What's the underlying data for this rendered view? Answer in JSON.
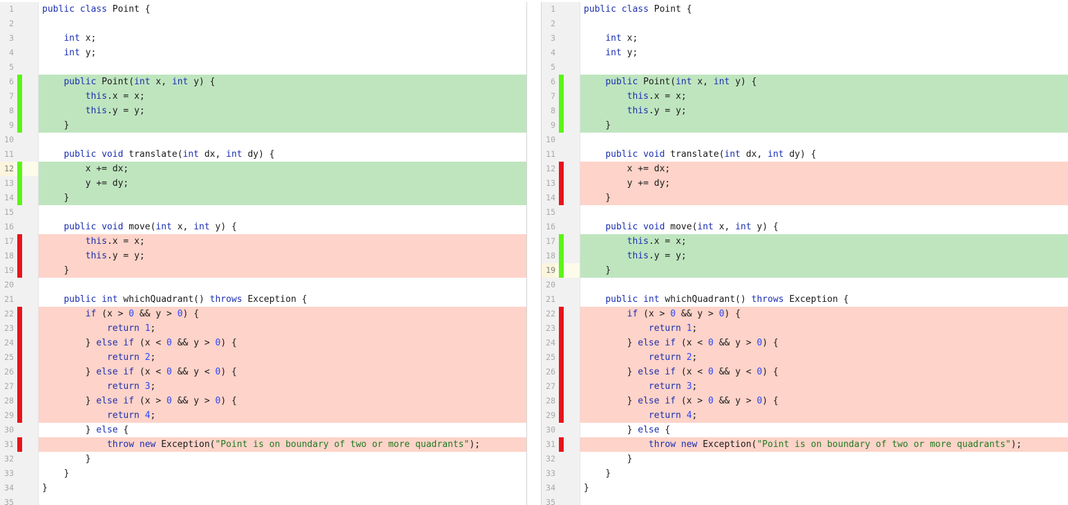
{
  "colors": {
    "added_bg": "#bfe5bf",
    "removed_bg": "#fed3c9",
    "added_marker": "#5bf514",
    "removed_marker": "#e8131a",
    "keyword": "#1b2fb0",
    "number": "#2a45ff",
    "string": "#1f7a1f"
  },
  "left": {
    "caret_line": 12,
    "lines": [
      {
        "n": "1",
        "status": "none",
        "text": "public class Point {"
      },
      {
        "n": "2",
        "status": "none",
        "text": ""
      },
      {
        "n": "3",
        "status": "none",
        "text": "    int x;"
      },
      {
        "n": "4",
        "status": "none",
        "text": "    int y;"
      },
      {
        "n": "5",
        "status": "none",
        "text": ""
      },
      {
        "n": "6",
        "status": "added",
        "text": "    public Point(int x, int y) {"
      },
      {
        "n": "7",
        "status": "added",
        "text": "        this.x = x;"
      },
      {
        "n": "8",
        "status": "added",
        "text": "        this.y = y;"
      },
      {
        "n": "9",
        "status": "added",
        "text": "    }"
      },
      {
        "n": "10",
        "status": "none",
        "text": ""
      },
      {
        "n": "11",
        "status": "none",
        "text": "    public void translate(int dx, int dy) {"
      },
      {
        "n": "12",
        "status": "added",
        "text": "        x += dx;"
      },
      {
        "n": "13",
        "status": "added",
        "text": "        y += dy;"
      },
      {
        "n": "14",
        "status": "added",
        "text": "    }"
      },
      {
        "n": "15",
        "status": "none",
        "text": ""
      },
      {
        "n": "16",
        "status": "none",
        "text": "    public void move(int x, int y) {"
      },
      {
        "n": "17",
        "status": "removed",
        "text": "        this.x = x;"
      },
      {
        "n": "18",
        "status": "removed",
        "text": "        this.y = y;"
      },
      {
        "n": "19",
        "status": "removed",
        "text": "    }"
      },
      {
        "n": "20",
        "status": "none",
        "text": ""
      },
      {
        "n": "21",
        "status": "none",
        "text": "    public int whichQuadrant() throws Exception {"
      },
      {
        "n": "22",
        "status": "removed",
        "text": "        if (x > 0 && y > 0) {"
      },
      {
        "n": "23",
        "status": "removed",
        "text": "            return 1;"
      },
      {
        "n": "24",
        "status": "removed",
        "text": "        } else if (x < 0 && y > 0) {"
      },
      {
        "n": "25",
        "status": "removed",
        "text": "            return 2;"
      },
      {
        "n": "26",
        "status": "removed",
        "text": "        } else if (x < 0 && y < 0) {"
      },
      {
        "n": "27",
        "status": "removed",
        "text": "            return 3;"
      },
      {
        "n": "28",
        "status": "removed",
        "text": "        } else if (x > 0 && y > 0) {"
      },
      {
        "n": "29",
        "status": "removed",
        "text": "            return 4;"
      },
      {
        "n": "30",
        "status": "none",
        "text": "        } else {"
      },
      {
        "n": "31",
        "status": "removed",
        "text": "            throw new Exception(\"Point is on boundary of two or more quadrants\");"
      },
      {
        "n": "32",
        "status": "none",
        "text": "        }"
      },
      {
        "n": "33",
        "status": "none",
        "text": "    }"
      },
      {
        "n": "34",
        "status": "none",
        "text": "}"
      },
      {
        "n": "35",
        "status": "none",
        "text": ""
      }
    ]
  },
  "right": {
    "caret_line": 19,
    "lines": [
      {
        "n": "1",
        "status": "none",
        "text": "public class Point {"
      },
      {
        "n": "2",
        "status": "none",
        "text": ""
      },
      {
        "n": "3",
        "status": "none",
        "text": "    int x;"
      },
      {
        "n": "4",
        "status": "none",
        "text": "    int y;"
      },
      {
        "n": "5",
        "status": "none",
        "text": ""
      },
      {
        "n": "6",
        "status": "added",
        "text": "    public Point(int x, int y) {"
      },
      {
        "n": "7",
        "status": "added",
        "text": "        this.x = x;"
      },
      {
        "n": "8",
        "status": "added",
        "text": "        this.y = y;"
      },
      {
        "n": "9",
        "status": "added",
        "text": "    }"
      },
      {
        "n": "10",
        "status": "none",
        "text": ""
      },
      {
        "n": "11",
        "status": "none",
        "text": "    public void translate(int dx, int dy) {"
      },
      {
        "n": "12",
        "status": "removed",
        "text": "        x += dx;"
      },
      {
        "n": "13",
        "status": "removed",
        "text": "        y += dy;"
      },
      {
        "n": "14",
        "status": "removed",
        "text": "    }"
      },
      {
        "n": "15",
        "status": "none",
        "text": ""
      },
      {
        "n": "16",
        "status": "none",
        "text": "    public void move(int x, int y) {"
      },
      {
        "n": "17",
        "status": "added",
        "text": "        this.x = x;"
      },
      {
        "n": "18",
        "status": "added",
        "text": "        this.y = y;"
      },
      {
        "n": "19",
        "status": "added",
        "text": "    }"
      },
      {
        "n": "20",
        "status": "none",
        "text": ""
      },
      {
        "n": "21",
        "status": "none",
        "text": "    public int whichQuadrant() throws Exception {"
      },
      {
        "n": "22",
        "status": "removed",
        "text": "        if (x > 0 && y > 0) {"
      },
      {
        "n": "23",
        "status": "removed",
        "text": "            return 1;"
      },
      {
        "n": "24",
        "status": "removed",
        "text": "        } else if (x < 0 && y > 0) {"
      },
      {
        "n": "25",
        "status": "removed",
        "text": "            return 2;"
      },
      {
        "n": "26",
        "status": "removed",
        "text": "        } else if (x < 0 && y < 0) {"
      },
      {
        "n": "27",
        "status": "removed",
        "text": "            return 3;"
      },
      {
        "n": "28",
        "status": "removed",
        "text": "        } else if (x > 0 && y > 0) {"
      },
      {
        "n": "29",
        "status": "removed",
        "text": "            return 4;"
      },
      {
        "n": "30",
        "status": "none",
        "text": "        } else {"
      },
      {
        "n": "31",
        "status": "removed",
        "text": "            throw new Exception(\"Point is on boundary of two or more quadrants\");"
      },
      {
        "n": "32",
        "status": "none",
        "text": "        }"
      },
      {
        "n": "33",
        "status": "none",
        "text": "    }"
      },
      {
        "n": "34",
        "status": "none",
        "text": "}"
      },
      {
        "n": "35",
        "status": "none",
        "text": ""
      }
    ]
  }
}
